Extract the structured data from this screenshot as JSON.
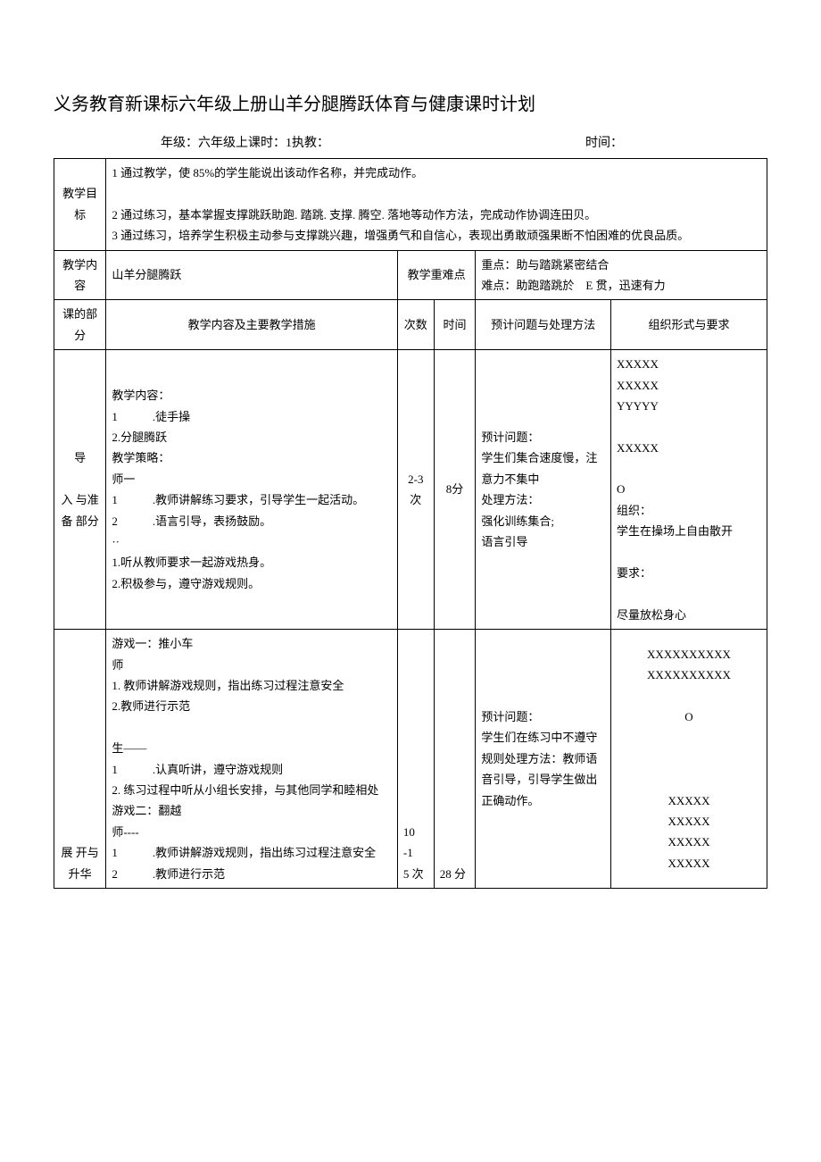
{
  "title": "义务教育新课标六年级上册山羊分腿腾跃体育与健康课时计划",
  "meta": {
    "grade_label": "年级：六年级上课时：1执教：",
    "time_label": "时间："
  },
  "rows": {
    "goal_label": "教学目标",
    "goal_text": "1 通过教学，使 85%的学生能说出该动作名称，并完成动作。\n\n2 通过练习，基本掌握支撑跳跃助跑. 踏跳. 支撑. 腾空. 落地等动作方法，完成动作协调连田贝。\n3 通过练习，培养学生积极主动参与支撑跳兴趣，增强勇气和自信心，表现出勇敢顽强果断不怕困难的优良品质。",
    "content_label": "教学内容",
    "content_text": "山羊分腿腾跃",
    "keypoint_label": "教学重难点",
    "keypoint_text": "重点：助与踏跳紧密结合\n难点：助跑踏跳於　E 贯，迅速有力",
    "section_label": "课的部分",
    "measures_label": "教学内容及主要教学措施",
    "count_label": "次数",
    "time_label": "时间",
    "problem_label": "预计问题与处理方法",
    "org_label": "组织形式与要求"
  },
  "section1": {
    "label": "导\n\n入 与准备 部分",
    "content": "教学内容：\n1　　　.徒手操\n2.分腿腾跃\n教学策略：\n师一\n1　　　.教师讲解练习要求，引导学生一起活动。\n2　　　.语言引导，表扬鼓励。\n··\n1.听从教师要求一起游戏热身。\n2.积极参与，遵守游戏规则。",
    "count": "2-3 次",
    "time": "8分",
    "problem": "预计问题：\n学生们集合速度慢，注意力不集中\n处理方法：\n强化训练集合;\n语言引导",
    "org": "XXXXX\nXXXXX\nYYYYY\n\nXXXXX\n\nO\n组织：\n学生在操场上自由散开\n\n要求：\n\n尽量放松身心"
  },
  "section2": {
    "label": "展 开与 升华",
    "content": "游戏一：推小车\n师\n1. 教师讲解游戏规则，指出练习过程注意安全\n2.教师进行示范\n\n生——\n1　　　.认真听讲，遵守游戏规则\n2. 练习过程中听从小组长安排，与其他同学和睦相处\n游戏二：翻越\n师----\n1　　　.教师讲解游戏规则，指出练习过程注意安全\n2　　　.教师进行示范",
    "count": "10\n-1\n5 次",
    "time": "28 分",
    "problem": "预计问题：\n学生们在练习中不遵守规则处理方法：教师语音引导，引导学生做出正确动作。",
    "org": "XXXXXXXXXX\nXXXXXXXXXX\n\nO\n\n\n\nXXXXX\nXXXXX\nXXXXX\nXXXXX"
  }
}
